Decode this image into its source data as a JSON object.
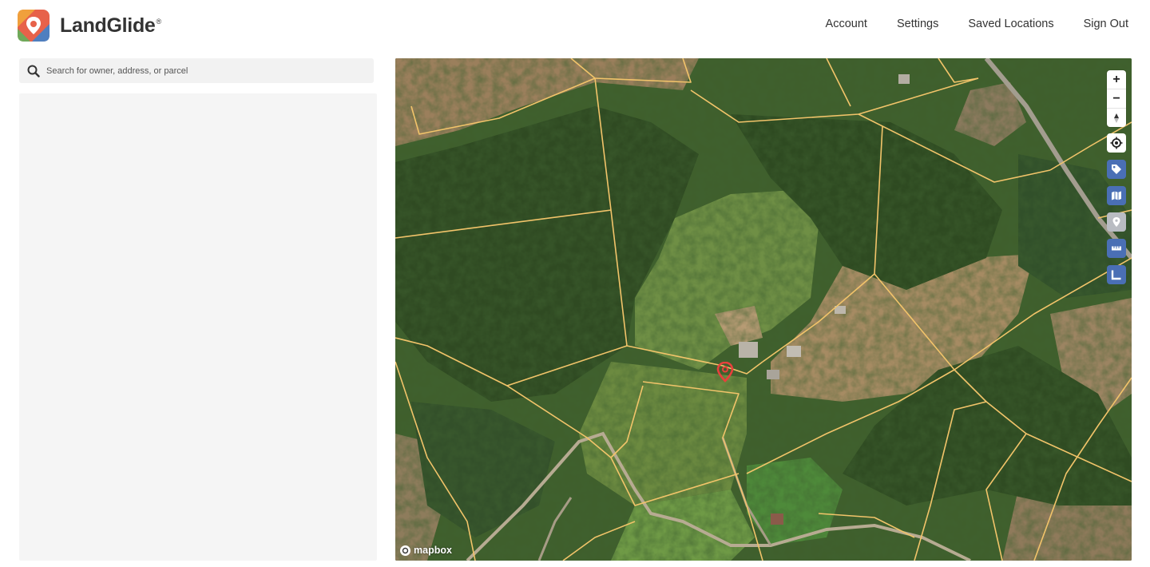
{
  "app": {
    "name": "LandGlide",
    "trademark": "®"
  },
  "nav": {
    "items": [
      {
        "label": "Account"
      },
      {
        "label": "Settings"
      },
      {
        "label": "Saved Locations"
      },
      {
        "label": "Sign Out"
      }
    ]
  },
  "search": {
    "placeholder": "Search for owner, address, or parcel",
    "value": ""
  },
  "map": {
    "attribution": "mapbox",
    "controls": {
      "zoom_in": "+",
      "zoom_out": "−",
      "compass_icon": "compass-icon",
      "locate_icon": "locate-icon",
      "tag_icon": "tag-icon",
      "map_layers_icon": "map-layers-icon",
      "pin_icon": "pin-icon",
      "ruler_icon": "ruler-icon",
      "area_icon": "area-measure-icon"
    },
    "colors": {
      "parcel_line": "#f2c46a",
      "marker": "#e8403d",
      "control_blue": "#4a6fb5"
    }
  }
}
